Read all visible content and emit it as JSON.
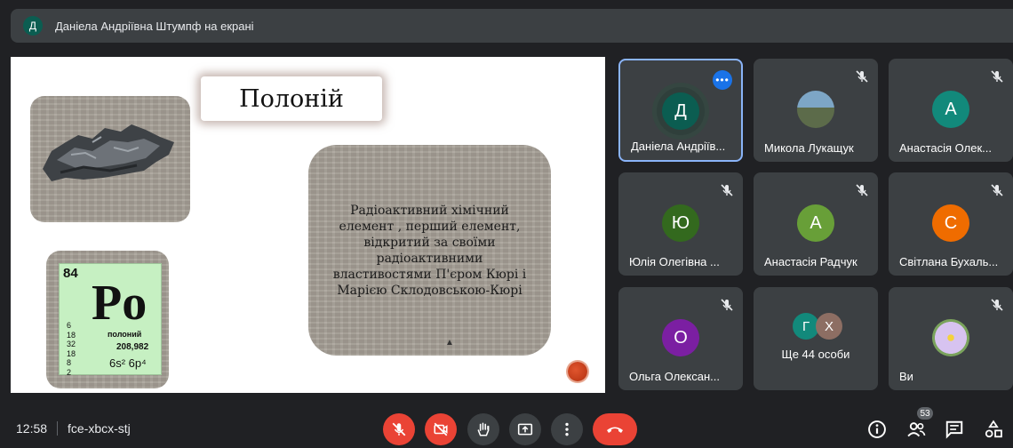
{
  "banner": {
    "avatar_letter": "Д",
    "text": "Даніела Андріївна Штумпф на екрані"
  },
  "slide": {
    "title": "Полоній",
    "description": "Радіоактивний хімічний елемент , перший елемент, відкритий за своїми радіоактивними властивостями П'єром Кюрі і Марією Склодовською-Кюрі",
    "element": {
      "number": "84",
      "symbol": "Po",
      "name": "полоний",
      "mass": "208,982",
      "shells": [
        "6",
        "18",
        "32",
        "18",
        "8",
        "2"
      ],
      "config": "6s² 6p⁴"
    }
  },
  "participants": [
    {
      "name": "Даніела Андріїв...",
      "letter": "Д",
      "color": "#0b5d51",
      "active": true
    },
    {
      "name": "Микола Лукащук",
      "letter": "",
      "color": "#7da6c6",
      "photo": true
    },
    {
      "name": "Анастасія Олек...",
      "letter": "А",
      "color": "#12897b"
    },
    {
      "name": "Юлія Олегівна ...",
      "letter": "Ю",
      "color": "#33691e"
    },
    {
      "name": "Анастасія Радчук",
      "letter": "А",
      "color": "#689f38"
    },
    {
      "name": "Світлана Бухаль...",
      "letter": "С",
      "color": "#ef6c00"
    },
    {
      "name": "Ольга Олексан...",
      "letter": "О",
      "color": "#7b1fa2"
    },
    {
      "name": "Ви",
      "letter": "",
      "color": "#7aa35c",
      "photo": true
    }
  ],
  "others": {
    "label": "Ще 44 особи",
    "letters": [
      "Г",
      "Х"
    ],
    "colors": [
      "#12897b",
      "#8d6e63"
    ]
  },
  "bottom": {
    "time": "12:58",
    "meeting_code": "fce-xbcx-stj",
    "people_count": "53"
  }
}
